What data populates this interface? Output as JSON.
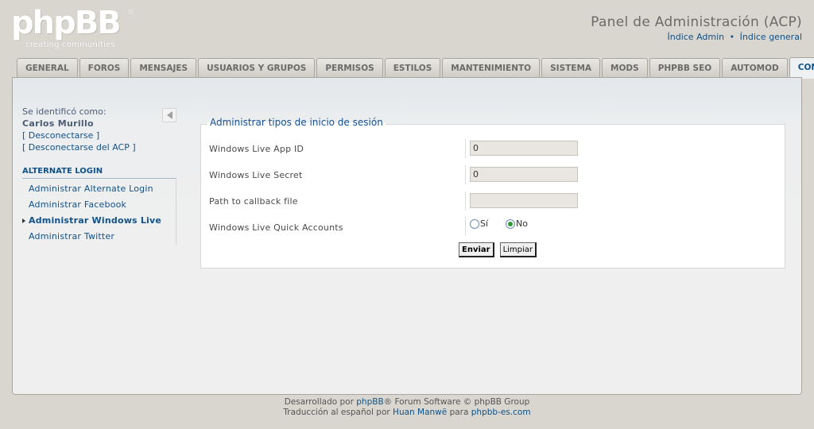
{
  "logo": {
    "word": "phpBB",
    "reg": "®",
    "tagline": "creating communities"
  },
  "header": {
    "title": "Panel de Administración (ACP)",
    "link_admin": "Índice Admin",
    "bullet": "•",
    "link_general": "Índice general"
  },
  "tabs": [
    {
      "label": "GENERAL"
    },
    {
      "label": "FOROS"
    },
    {
      "label": "MENSAJES"
    },
    {
      "label": "USUARIOS Y GRUPOS"
    },
    {
      "label": "PERMISOS"
    },
    {
      "label": "ESTILOS"
    },
    {
      "label": "MANTENIMIENTO"
    },
    {
      "label": "SISTEMA"
    },
    {
      "label": "MODS"
    },
    {
      "label": "PHPBB SEO"
    },
    {
      "label": "AUTOMOD"
    },
    {
      "label": "CONSOF"
    }
  ],
  "active_tab": "CONSOF",
  "sidebar": {
    "ident_label": "Se identificó como:",
    "username": "Carlos Murillo",
    "logout": "[ Desconectarse ]",
    "logout_acp": "[ Desconectarse del ACP ]",
    "menu_head": "ALTERNATE LOGIN",
    "items": [
      {
        "label": "Administrar Alternate Login"
      },
      {
        "label": "Administrar Facebook"
      },
      {
        "label": "Administrar Windows Live"
      },
      {
        "label": "Administrar Twitter"
      }
    ],
    "active_item": "Administrar Windows Live"
  },
  "form": {
    "legend": "Administrar tipos de inicio de sesión",
    "fields": [
      {
        "label": "Windows Live App ID",
        "value": "0"
      },
      {
        "label": "Windows Live Secret",
        "value": "0"
      },
      {
        "label": "Path to callback file",
        "value": ""
      }
    ],
    "quick_accounts": {
      "label": "Windows Live Quick Accounts",
      "options": [
        "Sí",
        "No"
      ],
      "selected": "No"
    },
    "submit": "Enviar",
    "reset": "Limpiar"
  },
  "footer": {
    "line1_pre": "Desarrollado por ",
    "line1_link": "phpBB",
    "line1_post": "® Forum Software © phpBB Group",
    "line2_pre": "Traducción al español por ",
    "line2_link1": "Huan Manwë",
    "line2_mid": " para ",
    "line2_link2": "phpbb-es.com"
  },
  "colors": {
    "link": "#105289",
    "background": "#d9d6cf",
    "radio_checked": "#2f9a2f"
  }
}
